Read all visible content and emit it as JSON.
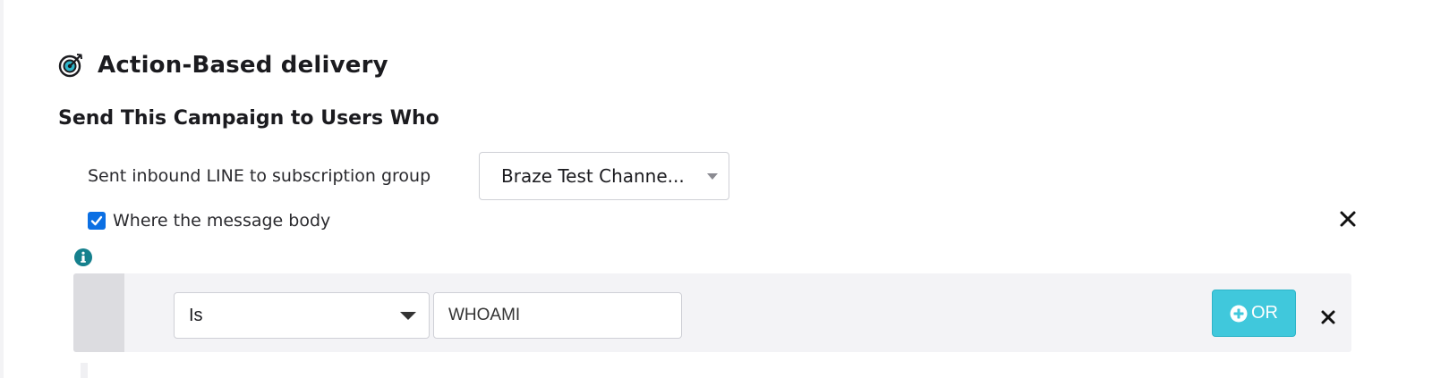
{
  "section": {
    "title": "Action-Based delivery",
    "icon": "target-icon"
  },
  "subheading": "Send This Campaign to Users Who",
  "trigger": {
    "label": "Sent inbound LINE to subscription group",
    "selected_group": "Braze Test Channe..."
  },
  "message_body_filter": {
    "checkbox_label": "Where the message body",
    "checked": true,
    "operator": "Is",
    "value": "WHOAMI",
    "or_button_label": "OR"
  },
  "colors": {
    "accent": "#40c8dc",
    "checkbox": "#0b6fe3",
    "icon_teal": "#15808d"
  }
}
